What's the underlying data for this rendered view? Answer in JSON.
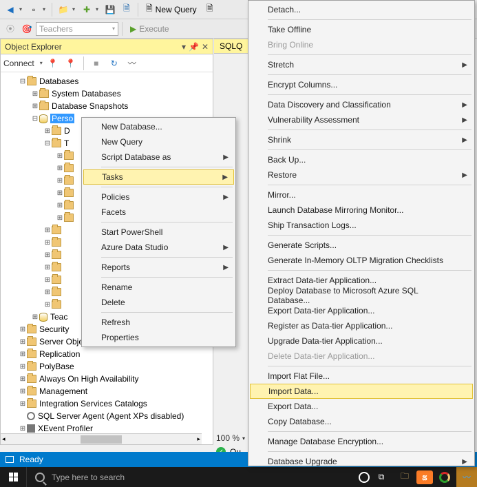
{
  "toolbar": {
    "new_query": "New Query",
    "teachers": "Teachers",
    "execute": "Execute"
  },
  "object_explorer": {
    "title": "Object Explorer",
    "connect": "Connect",
    "tree": {
      "root": "Databases",
      "sysdb": "System Databases",
      "snapshots": "Database Snapshots",
      "selected": "Perso",
      "trunc_d": "D",
      "trunc_t": "T",
      "teac": "Teac",
      "security": "Security",
      "server_objects": "Server Objects",
      "replication": "Replication",
      "polybase": "PolyBase",
      "aoha": "Always On High Availability",
      "management": "Management",
      "isc": "Integration Services Catalogs",
      "agent": "SQL Server Agent (Agent XPs disabled)",
      "xevent": "XEvent Profiler"
    }
  },
  "sql_tab": "SQLQ",
  "zoom": "100 %",
  "query_ok": "Qu",
  "status": {
    "ready": "Ready"
  },
  "taskbar": {
    "search": "Type here to search"
  },
  "ctx1": {
    "new_db": "New Database...",
    "new_query": "New Query",
    "script_db": "Script Database as",
    "tasks": "Tasks",
    "policies": "Policies",
    "facets": "Facets",
    "start_ps": "Start PowerShell",
    "ads": "Azure Data Studio",
    "reports": "Reports",
    "rename": "Rename",
    "delete": "Delete",
    "refresh": "Refresh",
    "properties": "Properties"
  },
  "ctx2": {
    "detach": "Detach...",
    "take_offline": "Take Offline",
    "bring_online": "Bring Online",
    "stretch": "Stretch",
    "encrypt": "Encrypt Columns...",
    "discovery": "Data Discovery and Classification",
    "vuln": "Vulnerability Assessment",
    "shrink": "Shrink",
    "backup": "Back Up...",
    "restore": "Restore",
    "mirror": "Mirror...",
    "launch_mirror": "Launch Database Mirroring Monitor...",
    "ship_logs": "Ship Transaction Logs...",
    "gen_scripts": "Generate Scripts...",
    "gen_oltp": "Generate In-Memory OLTP Migration Checklists",
    "extract_dt": "Extract Data-tier Application...",
    "deploy_azure": "Deploy Database to Microsoft Azure SQL Database...",
    "export_dt": "Export Data-tier Application...",
    "register_dt": "Register as Data-tier Application...",
    "upgrade_dt": "Upgrade Data-tier Application...",
    "delete_dt": "Delete Data-tier Application...",
    "import_flat": "Import Flat File...",
    "import_data": "Import Data...",
    "export_data": "Export Data...",
    "copy_db": "Copy Database...",
    "manage_enc": "Manage Database Encryption...",
    "db_upgrade": "Database Upgrade"
  }
}
